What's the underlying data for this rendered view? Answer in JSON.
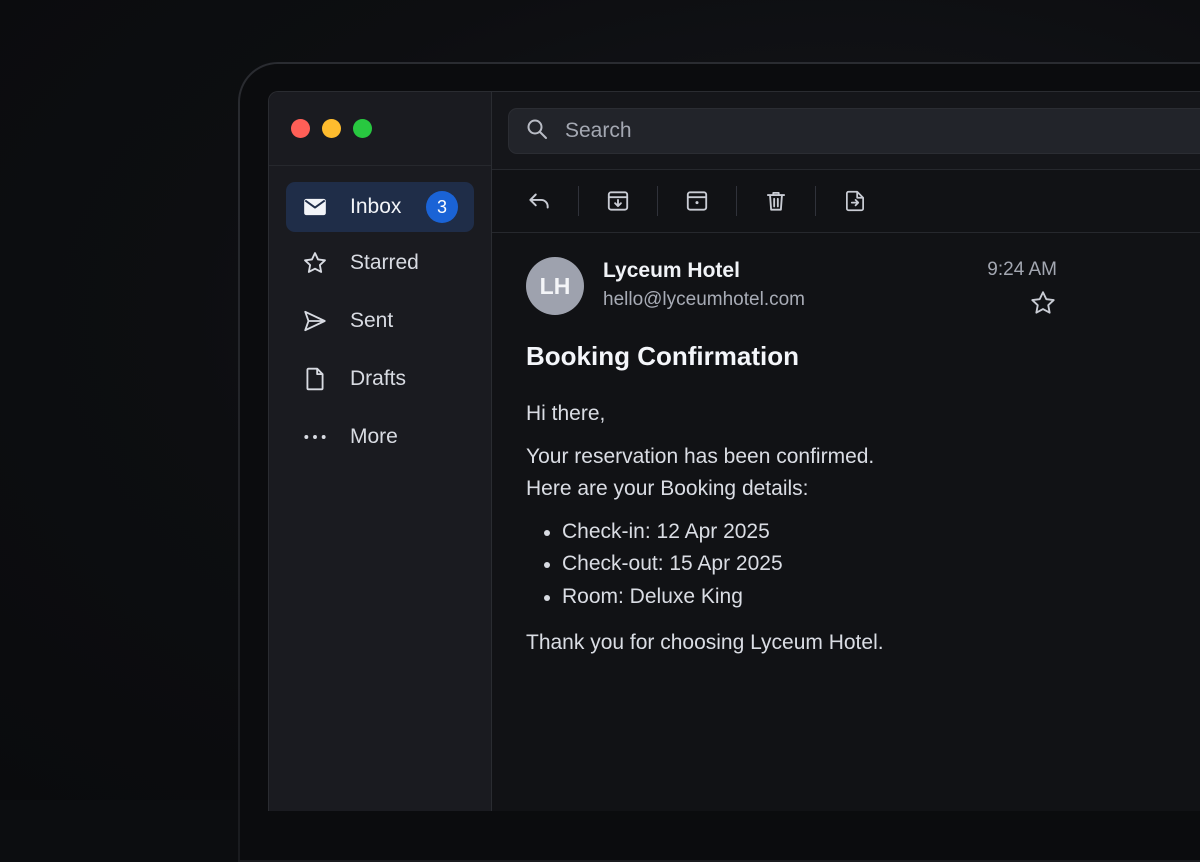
{
  "sidebar": {
    "items": [
      {
        "label": "Inbox",
        "icon": "envelope-icon",
        "badge": "3",
        "active": true
      },
      {
        "label": "Starred",
        "icon": "star-icon"
      },
      {
        "label": "Sent",
        "icon": "paper-plane-icon"
      },
      {
        "label": "Drafts",
        "icon": "document-icon"
      },
      {
        "label": "More",
        "icon": "more-dots-icon"
      }
    ]
  },
  "search": {
    "placeholder": "Search"
  },
  "toolbar": {
    "actions": [
      "reply-icon",
      "archive-icon",
      "folder-icon",
      "trash-icon",
      "move-icon"
    ]
  },
  "message": {
    "avatar_initials": "LH",
    "sender_name": "Lyceum Hotel",
    "sender_email": "hello@lyceumhotel.com",
    "time": "9:24 AM",
    "subject": "Booking Confirmation",
    "greeting": "Hi there,",
    "line1": "Your reservation has been confirmed.",
    "line2": "Here are your Booking details:",
    "details": [
      "Check-in: 12 Apr 2025",
      "Check-out: 15 Apr 2025",
      "Room: Deluxe King"
    ],
    "closing": "Thank you for choosing Lyceum Hotel."
  },
  "colors": {
    "accent": "#1a63d6",
    "active_bg": "#1f2d48",
    "traffic_red": "#ff5f57",
    "traffic_yellow": "#febc2e",
    "traffic_green": "#28c840"
  }
}
